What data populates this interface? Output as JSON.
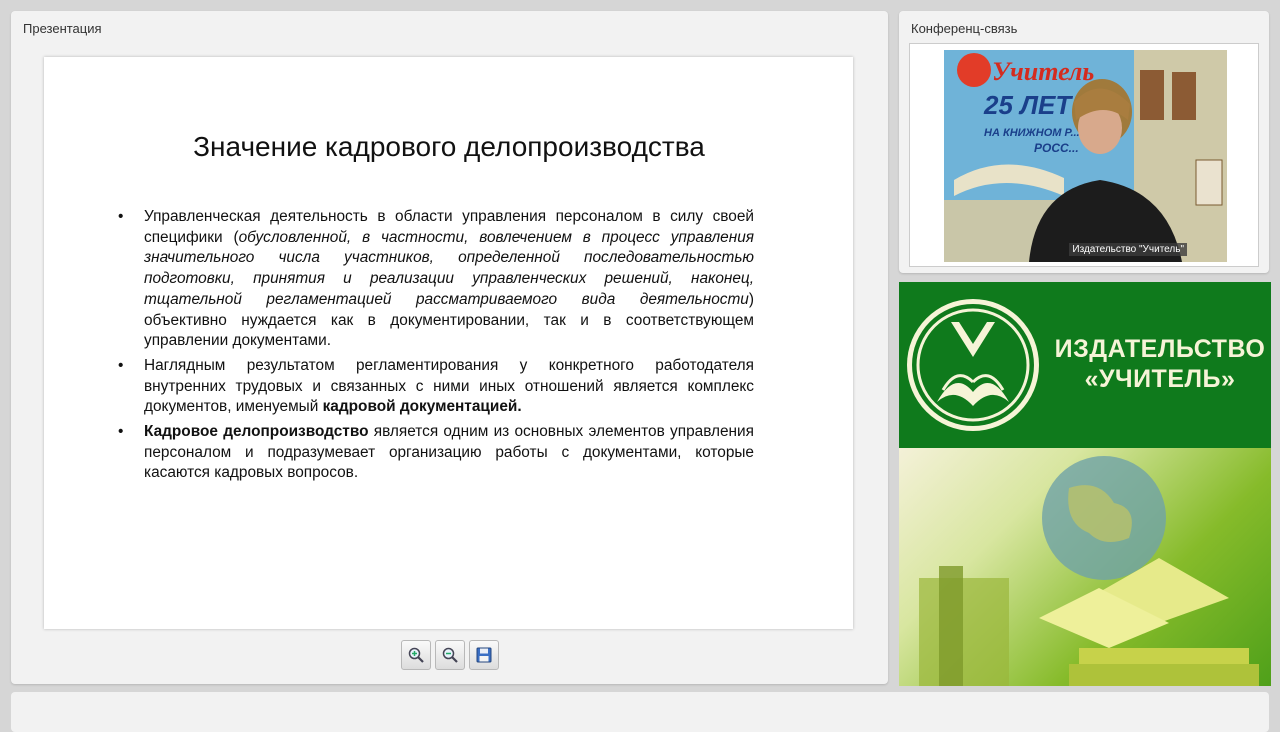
{
  "presentation": {
    "panel_title": "Презентация",
    "slide": {
      "title": "Значение кадрового делопроизводства",
      "bullets": [
        {
          "p1": "Управленческая деятельность в области управления персоналом в силу своей специфики (",
          "p2": "обусловленной, в частности, вовлечением в процесс управления значительного числа участников, определенной последовательностью подготовки, принятия и реализации управленческих решений, наконец, тщательной регламентацией рассматриваемого вида деятельности",
          "p3": ") объективно нуждается как в документировании, так и в соответствующем управлении документами."
        },
        {
          "p1": "Наглядным результатом регламентирования у конкретного работодателя внутренних трудовых и связанных с ними иных отношений является комплекс документов, именуемый ",
          "p2": "кадровой документацией."
        },
        {
          "p1": "Кадровое делопроизводство",
          "p2": " является одним из основных элементов управления персоналом и подразумевает организацию работы с документами, которые касаются кадровых вопросов."
        }
      ]
    },
    "tools": [
      {
        "icon": "zoom-in-icon"
      },
      {
        "icon": "zoom-out-icon"
      },
      {
        "icon": "save-icon"
      }
    ]
  },
  "conference": {
    "panel_title": "Конференц-связь",
    "video_caption": "Издательство \"Учитель\"",
    "backdrop_text": {
      "brand": "Учитель",
      "years": "25 ЛЕТ",
      "line1": "НА КНИЖНОМ Р...",
      "line2": "РОСС..."
    }
  },
  "banner": {
    "line1": "ИЗДАТЕЛЬСТВО",
    "line2": "«УЧИТЕЛЬ»",
    "colors": {
      "green": "#0f7a1c",
      "cream": "#f6f4d7",
      "lime": "#86bb2a"
    }
  }
}
